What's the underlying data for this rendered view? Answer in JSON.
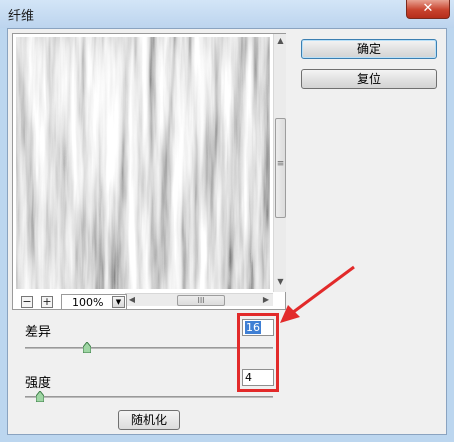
{
  "window": {
    "title": "纤维",
    "close_glyph": "✕"
  },
  "buttons": {
    "ok": "确定",
    "reset": "复位",
    "randomize": "随机化"
  },
  "zoom": {
    "minus": "−",
    "plus": "+",
    "level": "100%"
  },
  "params": [
    {
      "label": "差异",
      "value": "16",
      "slider_fraction": 0.25
    },
    {
      "label": "强度",
      "value": "4",
      "slider_fraction": 0.06
    }
  ],
  "annotation": {
    "color": "#e22a2a"
  }
}
